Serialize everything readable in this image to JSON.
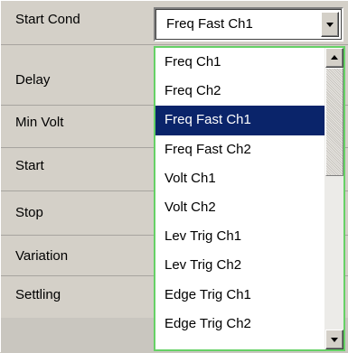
{
  "labels": {
    "start_cond": "Start Cond",
    "delay": "Delay",
    "min_volt": "Min Volt",
    "start": "Start",
    "stop": "Stop",
    "variation": "Variation",
    "settling": "Settling"
  },
  "combo": {
    "value": "Freq Fast Ch1"
  },
  "dropdown": {
    "items": [
      "Freq Ch1",
      "Freq Ch2",
      "Freq Fast Ch1",
      "Freq Fast Ch2",
      "Volt Ch1",
      "Volt Ch2",
      "Lev Trig Ch1",
      "Lev Trig Ch2",
      "Edge Trig Ch1",
      "Edge Trig Ch2"
    ],
    "selected": "Freq Fast Ch1"
  },
  "icons": {
    "combo_button": "chevron-down-icon",
    "scroll_up": "arrow-up-icon",
    "scroll_down": "arrow-down-icon"
  },
  "colors": {
    "selection_bg": "#0a246a",
    "selection_text": "#ffffff",
    "dropdown_border": "#66d166",
    "panel_bg": "#d4d0c8"
  }
}
